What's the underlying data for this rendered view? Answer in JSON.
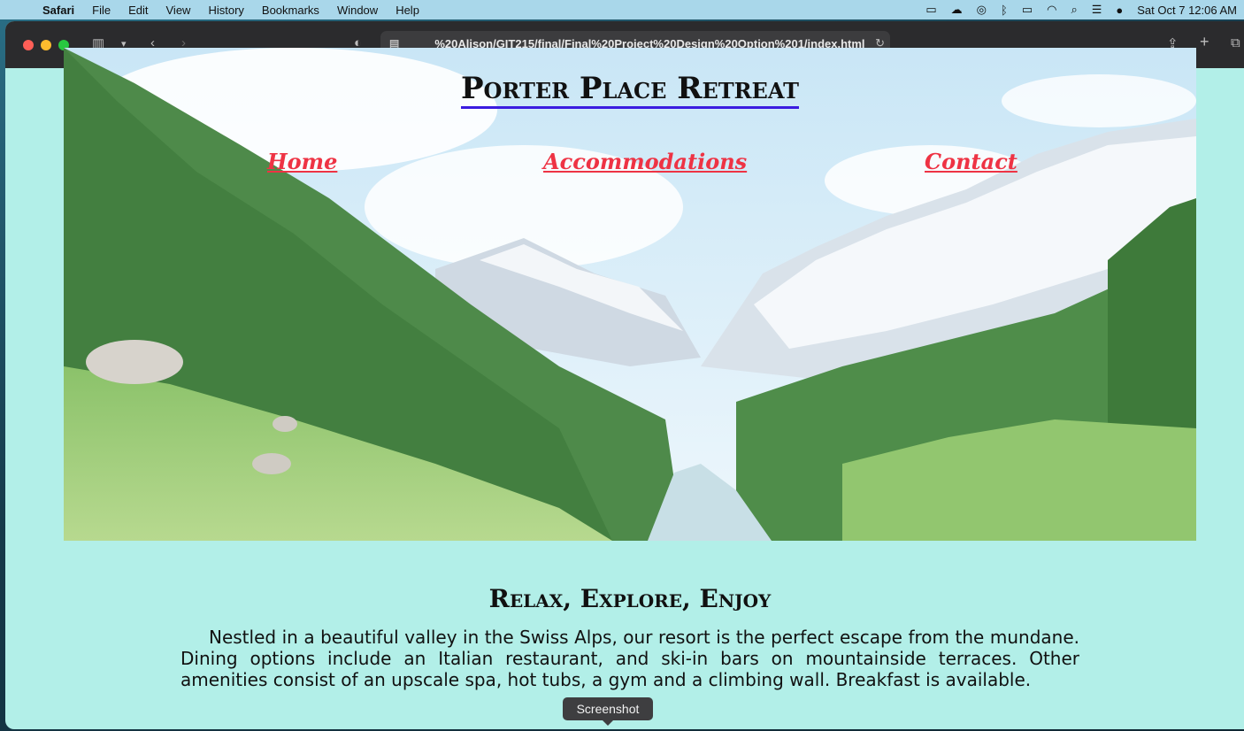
{
  "menubar": {
    "apple_icon": "apple-icon",
    "app_name": "Safari",
    "items": [
      "File",
      "Edit",
      "View",
      "History",
      "Bookmarks",
      "Window",
      "Help"
    ],
    "clock": "Sat Oct 7  12:06 AM"
  },
  "browser": {
    "url": "%20Alison/GIT215/final/Final%20Project%20Design%20Option%201/index.html",
    "tooltip": "Screenshot"
  },
  "page": {
    "title": "Porter Place Retreat",
    "nav": [
      "Home",
      "Accommodations",
      "Contact"
    ],
    "heading": "Relax, Explore, Enjoy",
    "paragraph": "Nestled in a beautiful valley in the Swiss Alps, our resort is the perfect escape from the mundane. Dining options include an Italian restaurant, and ski-in bars on mountainside terraces. Other amenities consist of an upscale spa, hot tubs, a gym and a climbing wall. Breakfast is available."
  },
  "colors": {
    "page_bg": "#b2efe8",
    "nav_link": "#ee3344",
    "title_underline": "#3a1be0"
  }
}
